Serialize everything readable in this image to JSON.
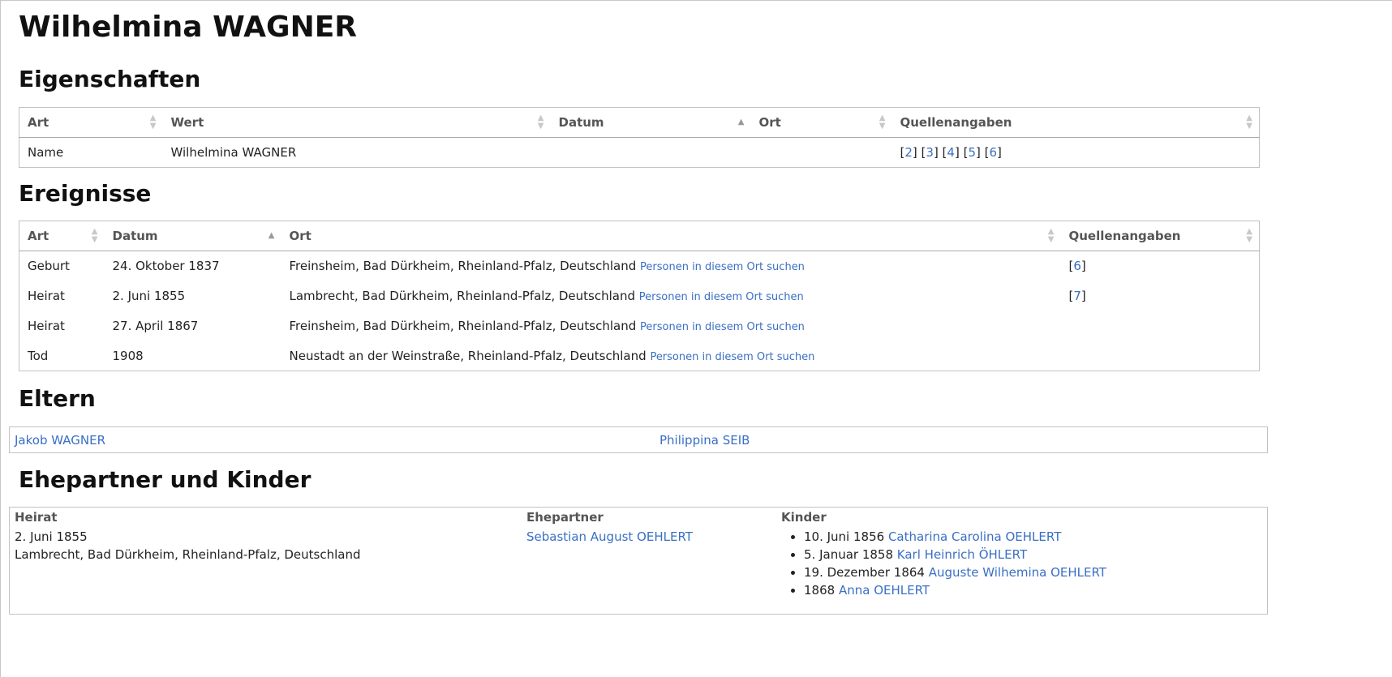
{
  "person": {
    "name": "Wilhelmina WAGNER"
  },
  "properties": {
    "heading": "Eigenschaften",
    "columns": [
      "Art",
      "Wert",
      "Datum",
      "Ort",
      "Quellenangaben"
    ],
    "rows": [
      {
        "art": "Name",
        "wert": "Wilhelmina WAGNER",
        "datum": "",
        "ort": "",
        "sources": [
          "2",
          "3",
          "4",
          "5",
          "6"
        ]
      }
    ]
  },
  "events": {
    "heading": "Ereignisse",
    "columns": [
      "Art",
      "Datum",
      "Ort",
      "Quellenangaben"
    ],
    "place_link_label": "Personen in diesem Ort suchen",
    "rows": [
      {
        "art": "Geburt",
        "datum": "24. Oktober 1837",
        "ort": "Freinsheim, Bad Dürkheim, Rheinland-Pfalz, Deutschland",
        "source": "6"
      },
      {
        "art": "Heirat",
        "datum": "2. Juni 1855",
        "ort": "Lambrecht, Bad Dürkheim, Rheinland-Pfalz, Deutschland",
        "source": "7"
      },
      {
        "art": "Heirat",
        "datum": "27. April 1867",
        "ort": "Freinsheim, Bad Dürkheim, Rheinland-Pfalz, Deutschland",
        "source": ""
      },
      {
        "art": "Tod",
        "datum": "1908",
        "ort": "Neustadt an der Weinstraße, Rheinland-Pfalz, Deutschland",
        "source": ""
      }
    ]
  },
  "parents": {
    "heading": "Eltern",
    "father": "Jakob WAGNER",
    "mother": "Philippina SEIB"
  },
  "family": {
    "heading": "Ehepartner und Kinder",
    "col_marriage": "Heirat",
    "col_spouse": "Ehepartner",
    "col_children": "Kinder",
    "marriage_date": "2. Juni 1855",
    "marriage_place": "Lambrecht, Bad Dürkheim, Rheinland-Pfalz, Deutschland",
    "spouse": "Sebastian August OEHLERT",
    "children": [
      {
        "date": "10. Juni 1856",
        "name": "Catharina Carolina OEHLERT"
      },
      {
        "date": "5. Januar 1858",
        "name": "Karl Heinrich ÖHLERT"
      },
      {
        "date": "19. Dezember 1864",
        "name": "Auguste Wilhemina OEHLERT"
      },
      {
        "date": "1868",
        "name": "Anna OEHLERT"
      }
    ]
  }
}
